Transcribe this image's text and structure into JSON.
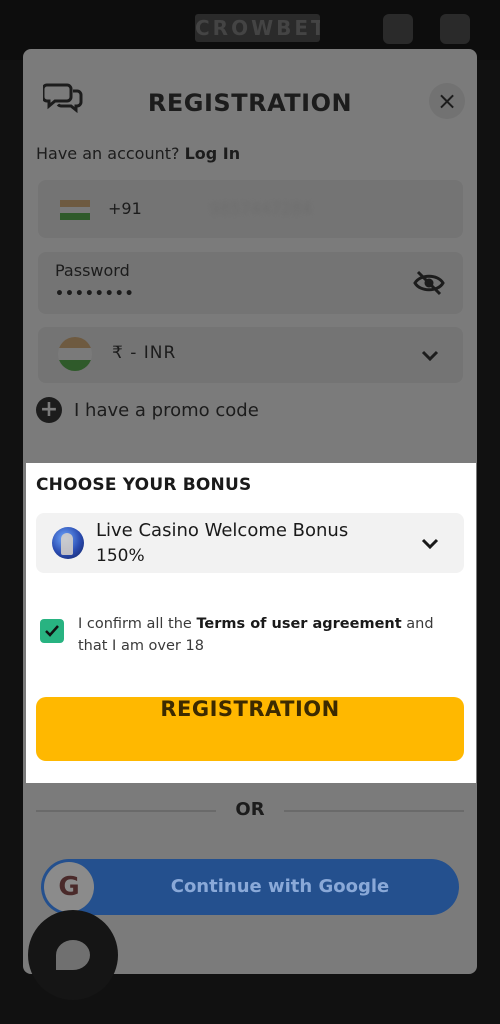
{
  "app": {
    "logo_text": "CROWBET"
  },
  "modal": {
    "title": "REGISTRATION",
    "close_glyph": "×",
    "login_prompt": "Have an account?",
    "login_link": "Log In",
    "phone": {
      "country_code": "+91",
      "number": "9857447284"
    },
    "password": {
      "label": "Password",
      "value": "••••••••"
    },
    "currency": {
      "value": "₹  -  INR"
    },
    "promo": {
      "label": "I have a promo code",
      "icon": "plus-icon"
    }
  },
  "bonus": {
    "heading": "CHOOSE YOUR BONUS",
    "selected_line1": "Live Casino Welcome Bonus",
    "selected_line2": "150%"
  },
  "agreement": {
    "text_before": "I confirm all the ",
    "link_text": "Terms of user agreement",
    "text_after": " and that I am over 18",
    "checked": true
  },
  "actions": {
    "register_label": "REGISTRATION",
    "or_label": "OR",
    "google_letter": "G",
    "google_label": "Continue with Google"
  },
  "colors": {
    "accent": "#ffb800",
    "checkbox": "#28b381",
    "google_button": "#2b5eb0"
  }
}
